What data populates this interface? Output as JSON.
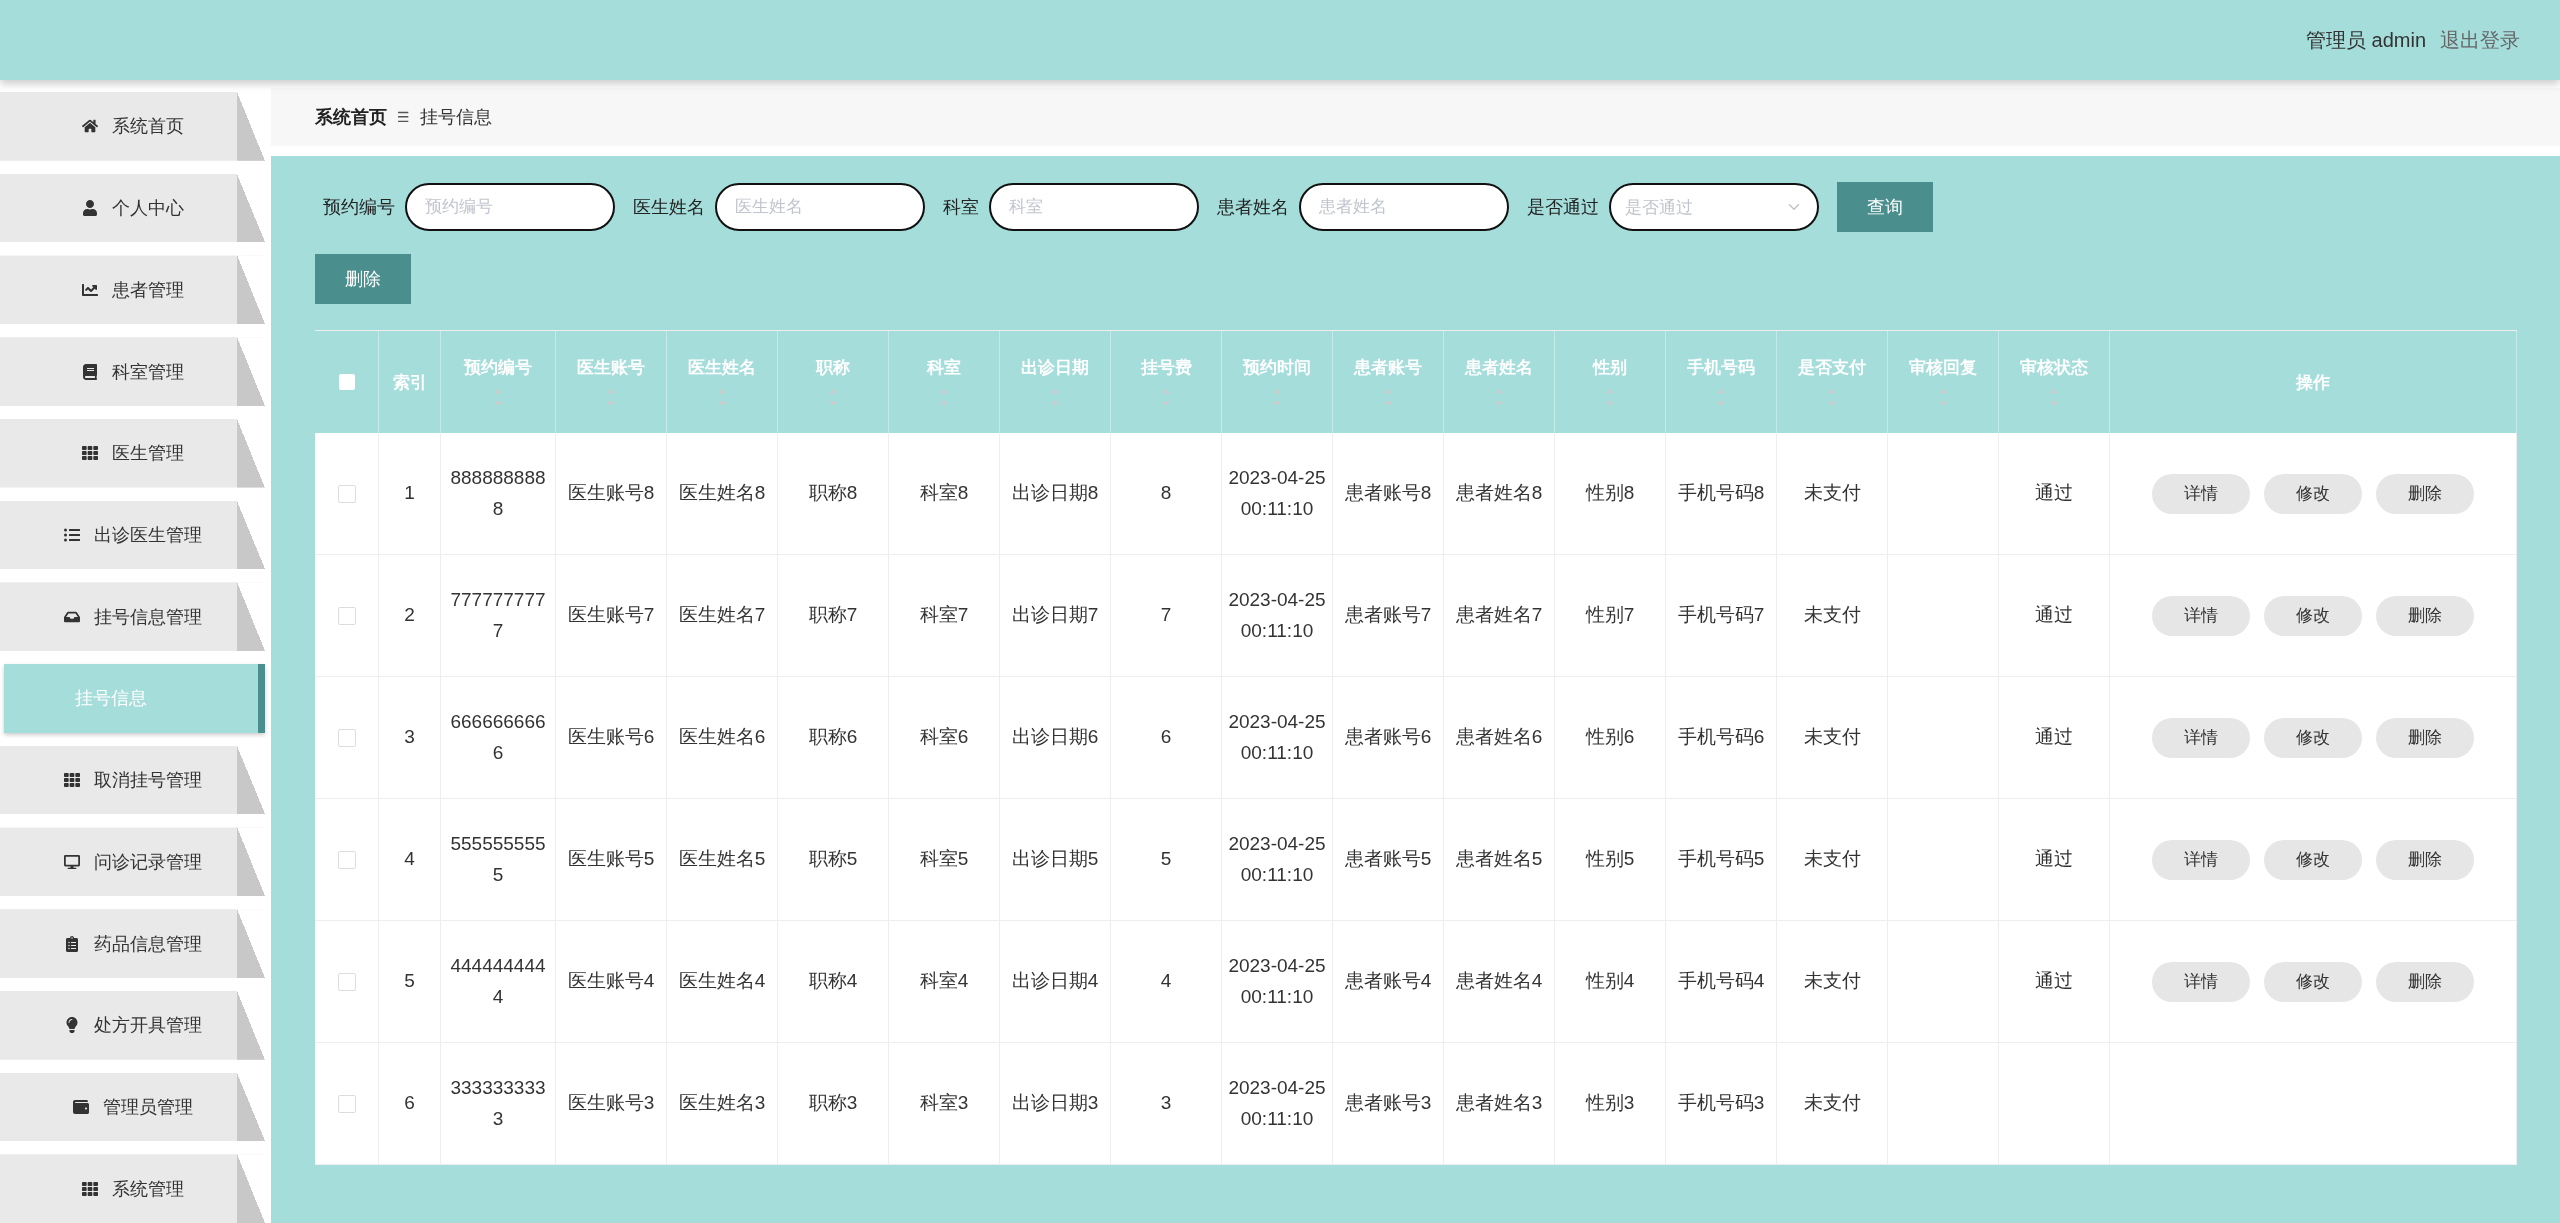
{
  "header": {
    "user": "管理员 admin",
    "logout": "退出登录"
  },
  "sidebar": {
    "items": [
      {
        "label": "系统首页",
        "selected": false
      },
      {
        "label": "个人中心",
        "selected": false
      },
      {
        "label": "患者管理",
        "selected": false
      },
      {
        "label": "科室管理",
        "selected": false
      },
      {
        "label": "医生管理",
        "selected": false
      },
      {
        "label": "出诊医生管理",
        "selected": false
      },
      {
        "label": "挂号信息管理",
        "selected": false
      },
      {
        "label": "挂号信息",
        "selected": true,
        "kind": "sub"
      },
      {
        "label": "取消挂号管理",
        "selected": false
      },
      {
        "label": "问诊记录管理",
        "selected": false
      },
      {
        "label": "药品信息管理",
        "selected": false
      },
      {
        "label": "处方开具管理",
        "selected": false
      },
      {
        "label": "管理员管理",
        "selected": false
      },
      {
        "label": "系统管理",
        "selected": false
      }
    ]
  },
  "breadcrumb": [
    "系统首页",
    "☰",
    "挂号信息"
  ],
  "search": {
    "fields": [
      {
        "label": "预约编号",
        "placeholder": "预约编号",
        "kind": "text"
      },
      {
        "label": "医生姓名",
        "placeholder": "医生姓名",
        "kind": "text"
      },
      {
        "label": "科室",
        "placeholder": "科室",
        "kind": "text"
      },
      {
        "label": "患者姓名",
        "placeholder": "患者姓名",
        "kind": "text"
      },
      {
        "label": "是否通过",
        "placeholder": "是否通过",
        "kind": "select"
      }
    ],
    "button": "查询"
  },
  "delete_button": "删除",
  "table": {
    "select_all": {
      "checked": false
    },
    "columns": [
      {
        "label": "索引",
        "sortable": false
      },
      {
        "label": "预约编号",
        "sortable": true
      },
      {
        "label": "医生账号",
        "sortable": true
      },
      {
        "label": "医生姓名",
        "sortable": true
      },
      {
        "label": "职称",
        "sortable": true
      },
      {
        "label": "科室",
        "sortable": true
      },
      {
        "label": "出诊日期",
        "sortable": true
      },
      {
        "label": "挂号费",
        "sortable": true
      },
      {
        "label": "预约时间",
        "sortable": true
      },
      {
        "label": "患者账号",
        "sortable": true
      },
      {
        "label": "患者姓名",
        "sortable": true
      },
      {
        "label": "性别",
        "sortable": true
      },
      {
        "label": "手机号码",
        "sortable": true
      },
      {
        "label": "是否支付",
        "sortable": true
      },
      {
        "label": "审核回复",
        "sortable": true
      },
      {
        "label": "审核状态",
        "sortable": true
      },
      {
        "label": "操作",
        "sortable": false
      }
    ],
    "rows": [
      {
        "checked": false,
        "cells": [
          "1",
          "8888888888",
          "医生账号8",
          "医生姓名8",
          "职称8",
          "科室8",
          "出诊日期8",
          "8",
          "2023-04-25 00:11:10",
          "患者账号8",
          "患者姓名8",
          "性别8",
          "手机号码8",
          "未支付",
          "",
          "通过"
        ],
        "actions": [
          "详情",
          "修改",
          "删除"
        ]
      },
      {
        "checked": false,
        "cells": [
          "2",
          "7777777777",
          "医生账号7",
          "医生姓名7",
          "职称7",
          "科室7",
          "出诊日期7",
          "7",
          "2023-04-25 00:11:10",
          "患者账号7",
          "患者姓名7",
          "性别7",
          "手机号码7",
          "未支付",
          "",
          "通过"
        ],
        "actions": [
          "详情",
          "修改",
          "删除"
        ]
      },
      {
        "checked": false,
        "cells": [
          "3",
          "6666666666",
          "医生账号6",
          "医生姓名6",
          "职称6",
          "科室6",
          "出诊日期6",
          "6",
          "2023-04-25 00:11:10",
          "患者账号6",
          "患者姓名6",
          "性别6",
          "手机号码6",
          "未支付",
          "",
          "通过"
        ],
        "actions": [
          "详情",
          "修改",
          "删除"
        ]
      },
      {
        "checked": false,
        "cells": [
          "4",
          "5555555555",
          "医生账号5",
          "医生姓名5",
          "职称5",
          "科室5",
          "出诊日期5",
          "5",
          "2023-04-25 00:11:10",
          "患者账号5",
          "患者姓名5",
          "性别5",
          "手机号码5",
          "未支付",
          "",
          "通过"
        ],
        "actions": [
          "详情",
          "修改",
          "删除"
        ]
      },
      {
        "checked": false,
        "cells": [
          "5",
          "4444444444",
          "医生账号4",
          "医生姓名4",
          "职称4",
          "科室4",
          "出诊日期4",
          "4",
          "2023-04-25 00:11:10",
          "患者账号4",
          "患者姓名4",
          "性别4",
          "手机号码4",
          "未支付",
          "",
          "通过"
        ],
        "actions": [
          "详情",
          "修改",
          "删除"
        ]
      },
      {
        "checked": false,
        "cells": [
          "6",
          "3333333333",
          "医生账号3",
          "医生姓名3",
          "职称3",
          "科室3",
          "出诊日期3",
          "3",
          "2023-04-25 00:11:10",
          "患者账号3",
          "患者姓名3",
          "性别3",
          "手机号码3",
          "未支付",
          "",
          ""
        ],
        "actions": []
      }
    ]
  }
}
